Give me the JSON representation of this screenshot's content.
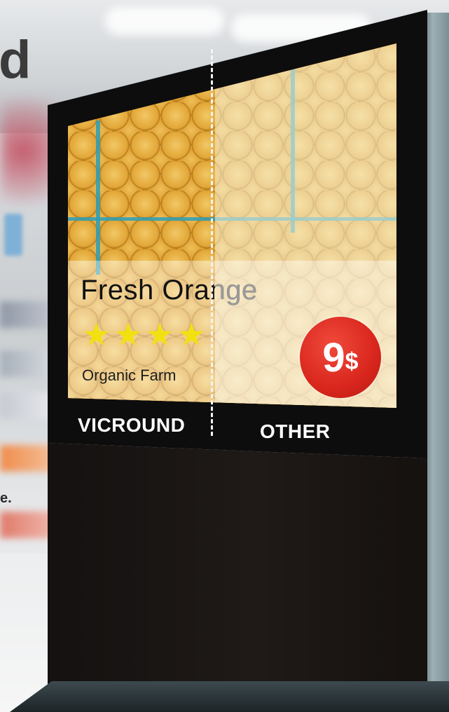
{
  "heading_fragment": "d",
  "body_fragment": "e.",
  "display": {
    "product_name": "Fresh Orange",
    "rating_stars": 4,
    "origin": "Organic Farm",
    "price_number": "9",
    "price_currency": "$"
  },
  "comparison": {
    "left_label": "VICROUND",
    "right_label": "OTHER"
  },
  "colors": {
    "star": "#f3e011",
    "price_badge": "#d9261d",
    "kiosk": "#0e0d0d",
    "crate": "#2a9db7"
  },
  "icons": {
    "star": "star-icon"
  }
}
